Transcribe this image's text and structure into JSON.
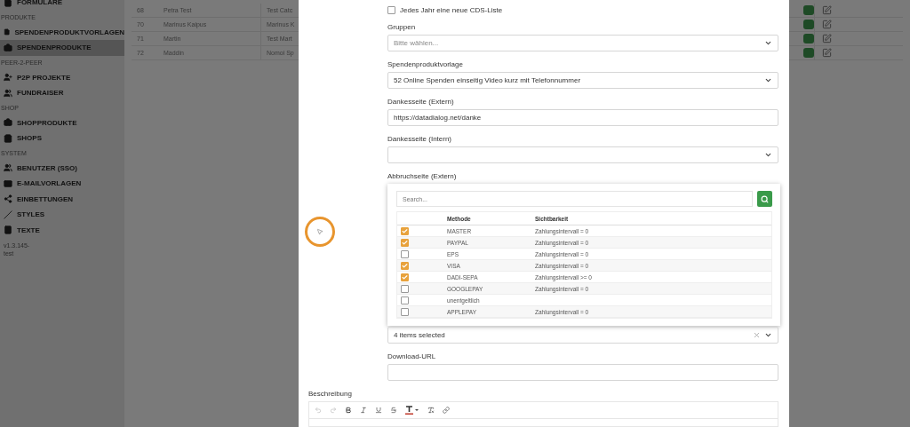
{
  "sidebar": {
    "sections": [
      {
        "items": [
          {
            "label": "FORMULARE",
            "selected": false
          }
        ]
      },
      {
        "header": "PRODUKTE",
        "items": [
          {
            "label": "SPENDENPRODUKTVORLAGEN",
            "selected": false
          },
          {
            "label": "SPENDENPRODUKTE",
            "selected": true
          }
        ]
      },
      {
        "header": "PEER-2-PEER",
        "items": [
          {
            "label": "P2P PROJEKTE",
            "selected": false
          },
          {
            "label": "FUNDRAISER",
            "selected": false
          }
        ]
      },
      {
        "header": "SHOP",
        "items": [
          {
            "label": "SHOPPRODUKTE",
            "selected": false
          },
          {
            "label": "SHOPS",
            "selected": false
          }
        ]
      },
      {
        "header": "SYSTEM",
        "items": [
          {
            "label": "BENUTZER (SSO)",
            "selected": false
          },
          {
            "label": "E-MAILVORLAGEN",
            "selected": false
          },
          {
            "label": "EINBETTUNGEN",
            "selected": false
          },
          {
            "label": "STYLES",
            "selected": false
          },
          {
            "label": "TEXTE",
            "selected": false
          }
        ]
      }
    ],
    "version": "v1.3.145-test"
  },
  "table": {
    "rows": [
      {
        "id": "68",
        "name": "Petra Test",
        "column_3": "Test Catc"
      },
      {
        "id": "70",
        "name": "Marinus Kaipus",
        "column_3": "Marinus K"
      },
      {
        "id": "71",
        "name": "Martin",
        "column_3": "Test Mart"
      },
      {
        "id": "72",
        "name": "Maddin",
        "column_3": "Nomoi Sp"
      }
    ]
  },
  "form": {
    "fields": [
      {
        "kind": "checkbox",
        "label": "Jedes Jahr eine neue CDS-Liste",
        "checked": false
      },
      {
        "kind": "select",
        "label": "Gruppen",
        "placeholder": "Bitte wählen..."
      },
      {
        "kind": "select",
        "label": "Spendenproduktvorlage",
        "value": "52 Online Spenden einseitig Video kurz mit Telefonnummer"
      },
      {
        "kind": "input",
        "label": "Dankesseite (Extern)",
        "value": "https://datadialog.net/danke"
      },
      {
        "kind": "select",
        "label": "Dankesseite (Intern)"
      },
      {
        "kind": "multiselect",
        "label": "Abbruchseite (Extern)",
        "value": "4 items selected",
        "dropdown": {
          "search_placeholder": "Search...",
          "columns": [
            "Methode",
            "Sichtbarkeit"
          ],
          "rows": [
            {
              "checked": true,
              "methode": "MASTER",
              "sichtbarkeit": "Zahlungsintervall = 0"
            },
            {
              "checked": true,
              "methode": "PAYPAL",
              "sichtbarkeit": "Zahlungsintervall = 0"
            },
            {
              "checked": false,
              "methode": "EPS",
              "sichtbarkeit": "Zahlungsintervall = 0"
            },
            {
              "checked": true,
              "methode": "VISA",
              "sichtbarkeit": "Zahlungsintervall = 0"
            },
            {
              "checked": true,
              "methode": "DADI-SEPA",
              "sichtbarkeit": "Zahlungsintervall >= 0"
            },
            {
              "checked": false,
              "methode": "GOOGLEPAY",
              "sichtbarkeit": "Zahlungsintervall = 0"
            },
            {
              "checked": false,
              "methode": "unentgeltlich"
            },
            {
              "checked": false,
              "methode": "APPLEPAY",
              "sichtbarkeit": "Zahlungsintervall = 0"
            }
          ]
        }
      },
      {
        "kind": "input",
        "label": "Download-URL"
      }
    ],
    "editor": {
      "label": "Beschreibung"
    }
  }
}
